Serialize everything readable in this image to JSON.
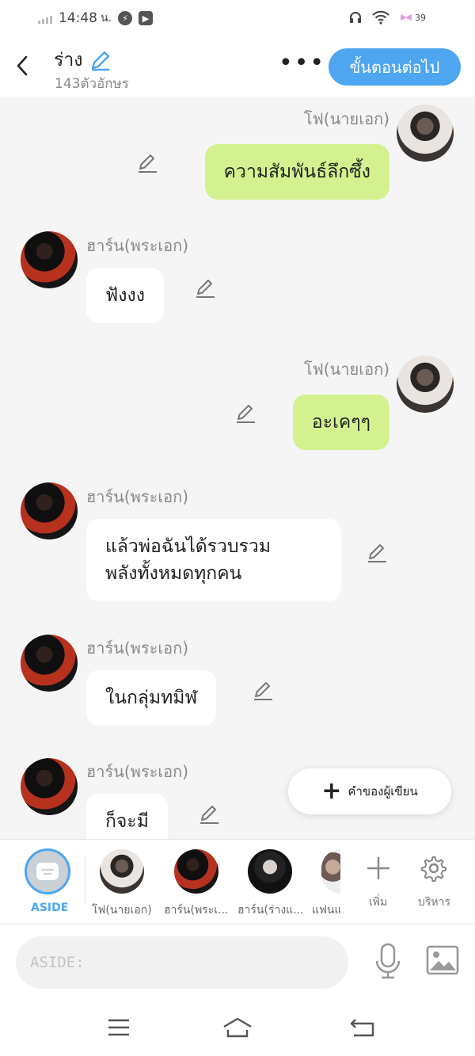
{
  "status_bar": {
    "time": "14:48",
    "time_suffix": "น.",
    "battery": "39"
  },
  "header": {
    "title": "ร่าง",
    "char_count": "143ตัวอักษร",
    "more_label": "•••",
    "next_button": "ขั้นตอนต่อไป"
  },
  "messages": [
    {
      "side": "right",
      "sender": "โฟ(นายเอก)",
      "text": "ความสัมพันธ์ลึกซึ้ง"
    },
    {
      "side": "left",
      "sender": "ฮาร์น(พระเอก)",
      "text": "ฟังงง"
    },
    {
      "side": "right",
      "sender": "โฟ(นายเอก)",
      "text": "อะเคๆๆ"
    },
    {
      "side": "left",
      "sender": "ฮาร์น(พระเอก)",
      "lines": [
        "แล้วพ่อฉันได้รวบรวม",
        "พลังทั้งหมดทุกคน"
      ]
    },
    {
      "side": "left",
      "sender": "ฮาร์น(พระเอก)",
      "text": "ในกลุ่มทมิฬ"
    },
    {
      "side": "left",
      "sender": "ฮาร์น(พระเอก)",
      "text": "ก็จะมี"
    }
  ],
  "fab": {
    "label": "คำของผู้เขียน"
  },
  "characters": {
    "aside_label": "ASIDE",
    "items": [
      {
        "label": "โฟ(นายเอก)"
      },
      {
        "label": "ฮาร์น(พระเ..."
      },
      {
        "label": "ฮาร์น(ร่างแ..."
      },
      {
        "label": "แฟนแ"
      }
    ],
    "add_label": "เพิ่ม",
    "manage_label": "บริหาร"
  },
  "input": {
    "placeholder": "ASIDE:"
  },
  "icons": {
    "back": "back-arrow-icon",
    "edit": "pencil-icon",
    "mic": "microphone-icon",
    "image": "image-icon",
    "add": "plus-icon",
    "settings": "gear-icon",
    "nav_menu": "menu-icon",
    "nav_home": "home-icon",
    "nav_back": "return-icon"
  },
  "colors": {
    "accent": "#4da6ef",
    "right_bubble": "#d3f28f",
    "left_bubble": "#ffffff",
    "background": "#f5f5f5"
  }
}
